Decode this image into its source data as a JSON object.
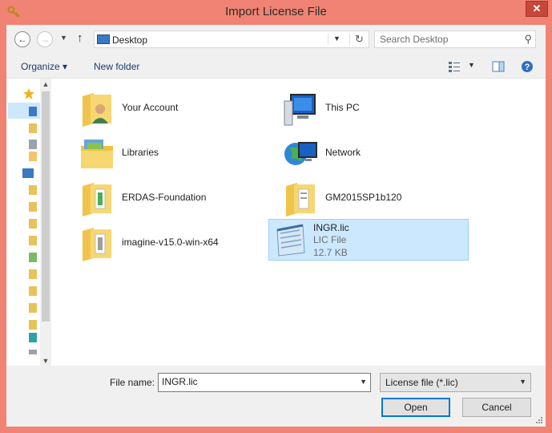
{
  "window": {
    "title": "Import License File",
    "close_glyph": "✕"
  },
  "address": {
    "location": "Desktop",
    "search_placeholder": "Search Desktop"
  },
  "toolbar": {
    "organize_label": "Organize ▾",
    "new_folder_label": "New folder"
  },
  "items": [
    {
      "name": "Your Account",
      "icon": "user-folder-icon"
    },
    {
      "name": "This PC",
      "icon": "computer-icon"
    },
    {
      "name": "Libraries",
      "icon": "libraries-icon"
    },
    {
      "name": "Network",
      "icon": "network-icon"
    },
    {
      "name": "ERDAS-Foundation",
      "icon": "folder-icon"
    },
    {
      "name": "GM2015SP1b120",
      "icon": "folder-icon"
    },
    {
      "name": "imagine-v15.0-win-x64",
      "icon": "folder-icon"
    },
    {
      "name": "INGR.lic",
      "icon": "notepad-file-icon",
      "type": "LIC File",
      "size": "12.7 KB",
      "selected": true
    }
  ],
  "bottom": {
    "file_name_label": "File name:",
    "file_name_value": "INGR.lic",
    "filter_value": "License file (*.lic)",
    "open_label": "Open",
    "cancel_label": "Cancel"
  },
  "colors": {
    "titlebar": "#f08373",
    "selection": "#cce8ff",
    "close": "#c7473b"
  }
}
